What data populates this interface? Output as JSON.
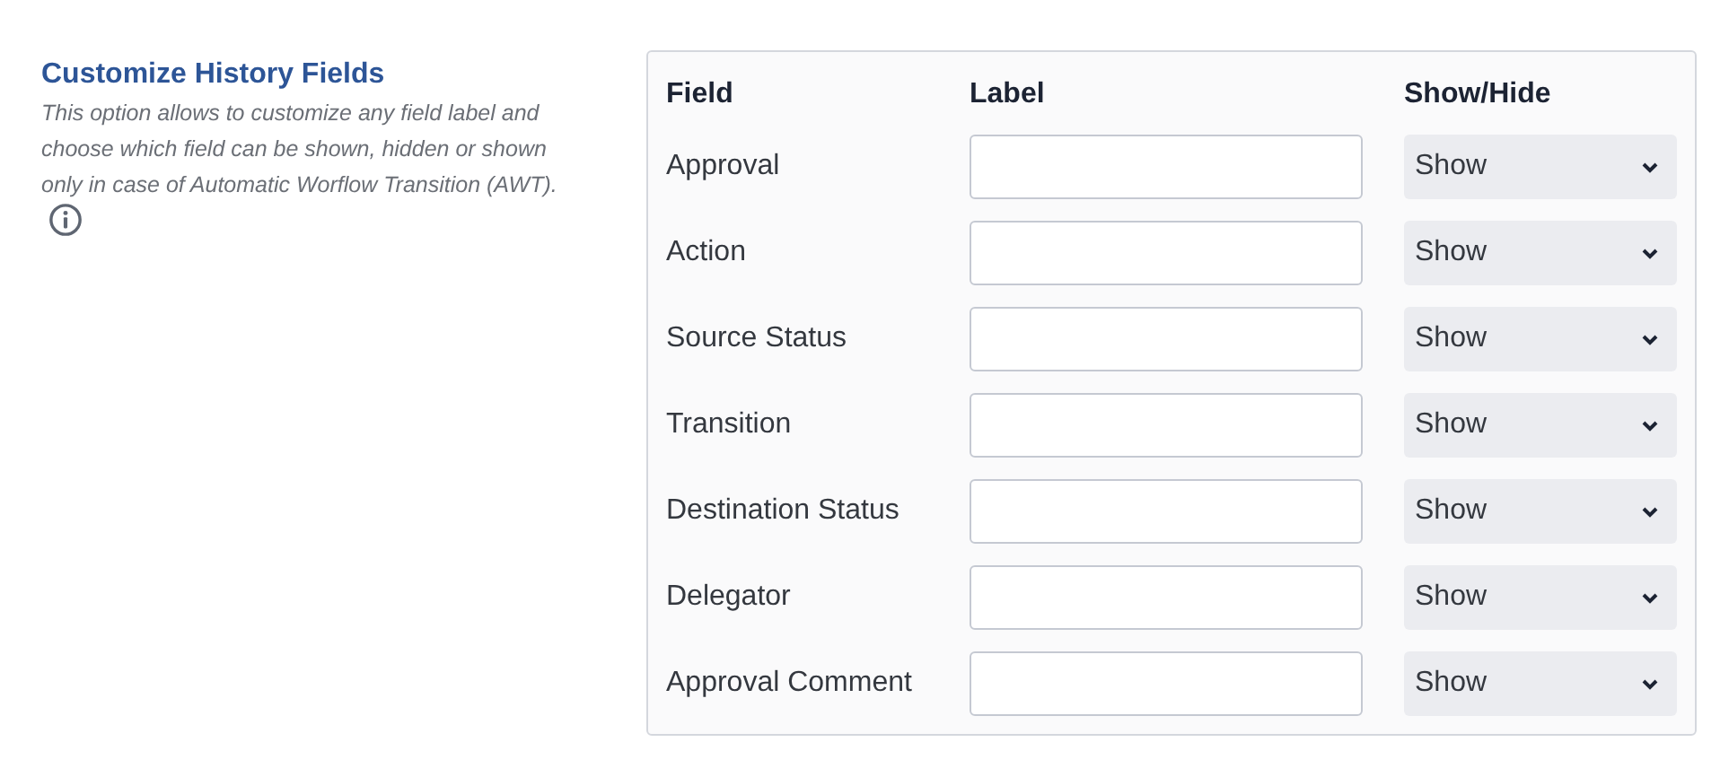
{
  "section": {
    "title": "Customize History Fields",
    "description": "This option allows to customize any field label and choose which field can be shown, hidden or shown only in case of Automatic Worflow Transition (AWT)."
  },
  "table": {
    "columns": [
      "Field",
      "Label",
      "Show/Hide"
    ],
    "rows": [
      {
        "field": "Approval",
        "select": "Show"
      },
      {
        "field": "Action",
        "select": "Show"
      },
      {
        "field": "Source Status",
        "select": "Show"
      },
      {
        "field": "Transition",
        "select": "Show"
      },
      {
        "field": "Destination Status",
        "select": "Show"
      },
      {
        "field": "Delegator",
        "select": "Show"
      },
      {
        "field": "Approval Comment",
        "select": "Show"
      }
    ]
  }
}
